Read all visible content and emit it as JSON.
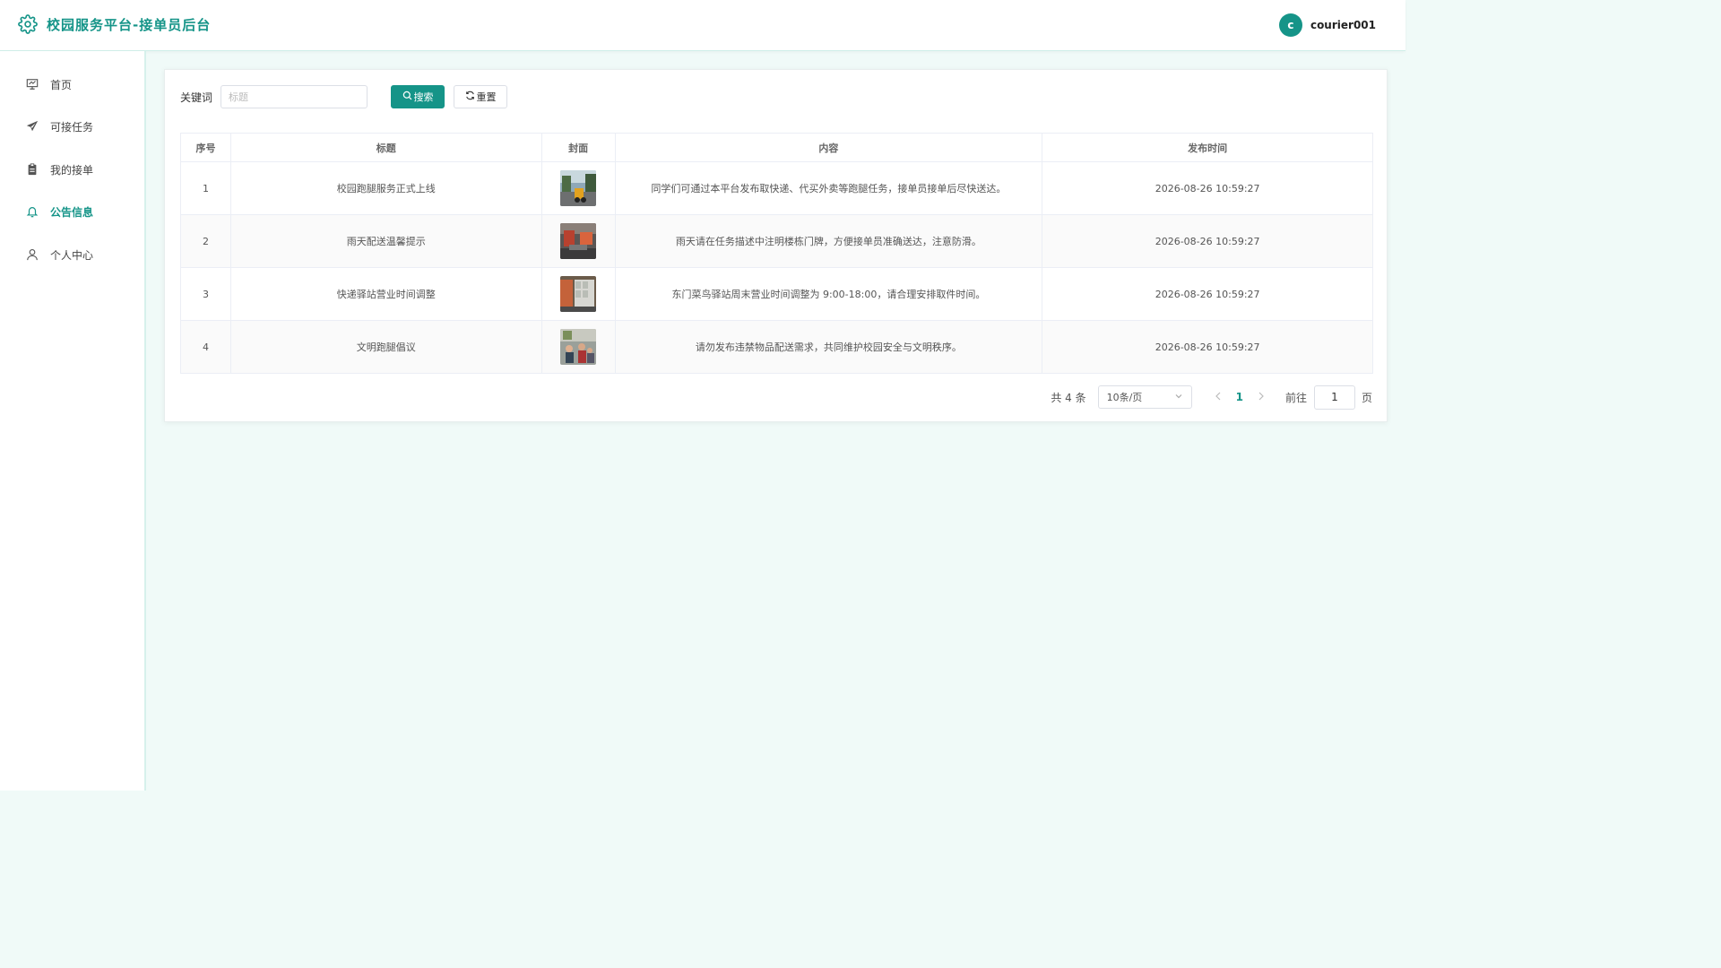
{
  "header": {
    "title": "校园服务平台-接单员后台",
    "avatar_letter": "c",
    "username": "courier001"
  },
  "colors": {
    "accent": "#159488",
    "background": "#f0faf8"
  },
  "sidebar": {
    "items": [
      {
        "label": "首页",
        "icon": "presentation-icon",
        "active": false
      },
      {
        "label": "可接任务",
        "icon": "send-icon",
        "active": false
      },
      {
        "label": "我的接单",
        "icon": "clipboard-icon",
        "active": false
      },
      {
        "label": "公告信息",
        "icon": "bell-icon",
        "active": true
      },
      {
        "label": "个人中心",
        "icon": "user-icon",
        "active": false
      }
    ]
  },
  "filter": {
    "label": "关键词",
    "placeholder": "标题",
    "search_label": "搜索",
    "reset_label": "重置"
  },
  "table": {
    "headers": [
      "序号",
      "标题",
      "封面",
      "内容",
      "发布时间"
    ],
    "rows": [
      {
        "index": "1",
        "title": "校园跑腿服务正式上线",
        "cover": "campus-street-photo",
        "content": "同学们可通过本平台发布取快递、代买外卖等跑腿任务，接单员接单后尽快送达。",
        "time": "2026-08-26 10:59:27"
      },
      {
        "index": "2",
        "title": "雨天配送温馨提示",
        "cover": "rainy-delivery-photo",
        "content": "雨天请在任务描述中注明楼栋门牌，方便接单员准确送达，注意防滑。",
        "time": "2026-08-26 10:59:27"
      },
      {
        "index": "3",
        "title": "快递驿站营业时间调整",
        "cover": "parcel-station-photo",
        "content": "东门菜鸟驿站周末营业时间调整为 9:00-18:00，请合理安排取件时间。",
        "time": "2026-08-26 10:59:27"
      },
      {
        "index": "4",
        "title": "文明跑腿倡议",
        "cover": "courier-group-photo",
        "content": "请勿发布违禁物品配送需求，共同维护校园安全与文明秩序。",
        "time": "2026-08-26 10:59:27"
      }
    ]
  },
  "pagination": {
    "total": "共 4 条",
    "page_size": "10条/页",
    "current_page": "1",
    "goto_label": "前往",
    "goto_value": "1",
    "page_unit": "页"
  }
}
